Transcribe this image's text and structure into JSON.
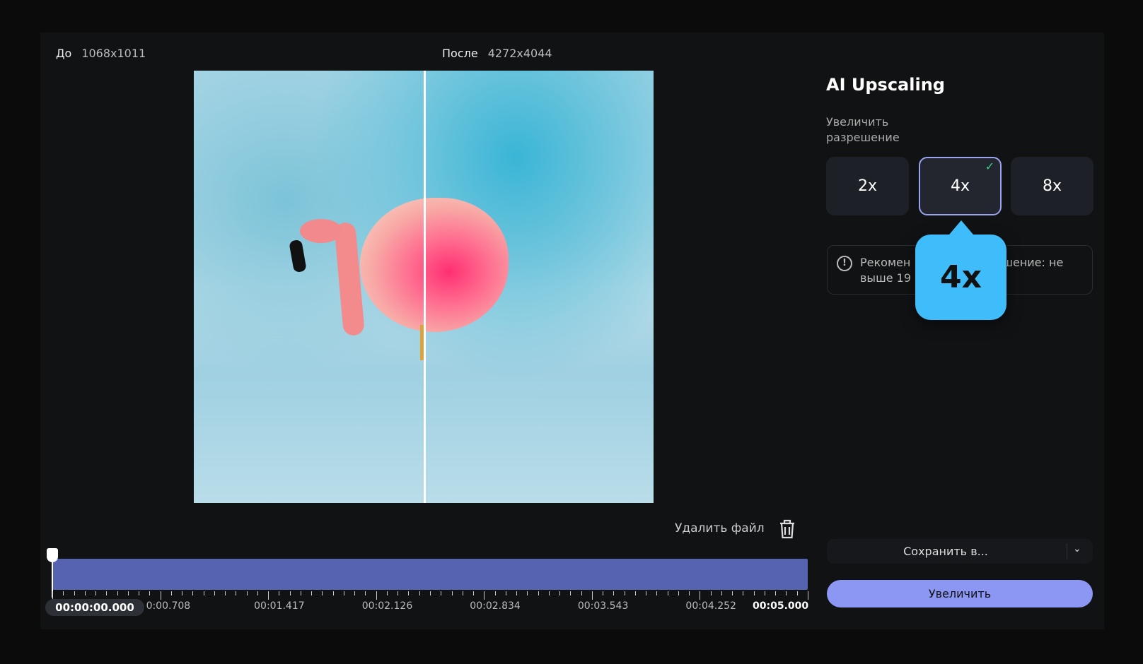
{
  "preview": {
    "before_label": "До",
    "before_res": "1068x1011",
    "after_label": "После",
    "after_res": "4272x4044"
  },
  "sidebar": {
    "title": "AI Upscaling",
    "subtitle_1": "Увеличить",
    "subtitle_2": "разрешение",
    "scale_options": [
      {
        "label": "2x"
      },
      {
        "label": "4x",
        "selected": true
      },
      {
        "label": "8x"
      }
    ],
    "info_line1_a": "Рекомен",
    "info_line1_b": "шение: не",
    "info_line2": "выше 19",
    "tooltip": "4x",
    "save_label": "Сохранить в...",
    "enlarge_label": "Увеличить"
  },
  "delete_label": "Удалить файл",
  "timeline": {
    "current": "00:00:00.000",
    "labels": [
      "0:00.708",
      "00:01.417",
      "00:02.126",
      "00:02.834",
      "00:03.543",
      "00:04.252",
      "00:05.000"
    ],
    "progress": 0
  },
  "colors": {
    "accent": "#8c97f4",
    "track": "#5563b0",
    "tooltip": "#3fbdfb",
    "check": "#3ecf8e"
  }
}
